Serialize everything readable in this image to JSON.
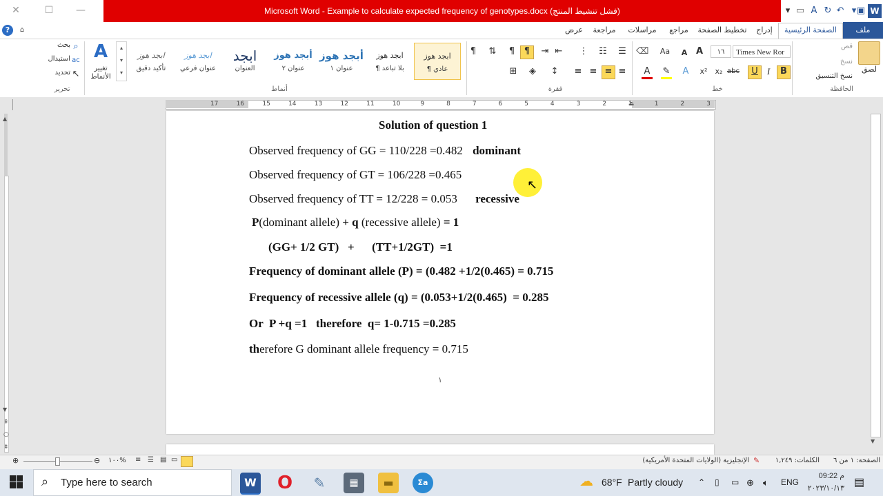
{
  "window": {
    "title": "Microsoft Word - Example to calculate expected frequency of genotypes.docx (فشل تنشيط المنتج)",
    "buttons": {
      "close": "✕",
      "restore": "☐",
      "minimize": "—"
    }
  },
  "tabs": {
    "file": "ملف",
    "home": "الصفحة الرئيسية",
    "insert": "إدراج",
    "layout": "تخطيط الصفحة",
    "references": "مراجع",
    "mailings": "مراسلات",
    "review": "مراجعة",
    "view": "عرض"
  },
  "ribbon": {
    "clipboard": {
      "label": "الحافظة",
      "paste": "لصق",
      "cut": "قص",
      "copy": "نسخ",
      "format_painter": "نسخ التنسيق"
    },
    "font": {
      "label": "خط",
      "name": "Times New Ror",
      "size": "١٦"
    },
    "paragraph": {
      "label": "فقرة"
    },
    "styles": {
      "label": "أنماط",
      "items": [
        {
          "sample": "ابجد هوز",
          "name": "¶ عادي"
        },
        {
          "sample": "ابجد هوز",
          "name": "¶ بلا تباعد"
        },
        {
          "sample": "أبجد هوز",
          "name": "عنوان ١"
        },
        {
          "sample": "أبجد هوز",
          "name": "عنوان ٢"
        },
        {
          "sample": "ابجد",
          "name": "العنوان"
        },
        {
          "sample": "ابجد هوز",
          "name": "عنوان فرعي"
        },
        {
          "sample": "ابجد هوز",
          "name": "تأكيد دقيق"
        }
      ],
      "change_styles": "تغيير الأنماط"
    },
    "editing": {
      "label": "تحرير",
      "find": "بحث",
      "replace": "استبدال",
      "select": "تحديد"
    }
  },
  "ruler": {
    "numbers": [
      "3",
      "2",
      "1",
      "1",
      "2",
      "3",
      "4",
      "5",
      "6",
      "7",
      "8",
      "9",
      "10",
      "11",
      "12",
      "13",
      "14",
      "15",
      "16",
      "17"
    ]
  },
  "document": {
    "heading": "Solution of  question 1",
    "line1": "Observed frequency of GG = 110/228 =0.482",
    "line1_tag": "dominant",
    "line2": "Observed frequency of GT = 106/228 =0.465",
    "line3": "Observed frequency of TT = 12/228 = 0.053",
    "line3_tag": "recessive",
    "line4_p": "P",
    "line4_a": "(dominant allele) ",
    "line4_b": "+ q",
    "line4_c": " (recessive allele) ",
    "line4_d": "= 1",
    "line5": "(GG+ 1/2 GT)   +      (TT+1/2GT)  =1",
    "line6": "Frequency of dominant allele (P) = (0.482 +1/2(0.465) = 0.715",
    "line7": "Frequency of recessive allele (q) = (0.053+1/2(0.465)  = 0.285",
    "line8": "Or  P +q =1   therefore  q= 1-0.715 =0.285",
    "line9_a": "th",
    "line9_b": "erefore  G dominant allele frequency = 0.715",
    "page_number": "١"
  },
  "statusbar": {
    "page": "الصفحة: ١ من ٦",
    "words": "الكلمات: ١,٢٤٩",
    "language": "الإنجليزية (الولايات المتحدة الأمريكية)",
    "zoom": "١٠٠%"
  },
  "taskbar": {
    "search_placeholder": "Type here to search",
    "weather_temp": "68°F",
    "weather_text": "Partly cloudy",
    "lang": "ENG",
    "time": "09:22 م",
    "date": "٢٠٢٣/١٠/١٣"
  },
  "colors": {
    "title_red": "#e00000",
    "word_blue": "#2b579a",
    "taskbar": "#dfe6ef"
  }
}
